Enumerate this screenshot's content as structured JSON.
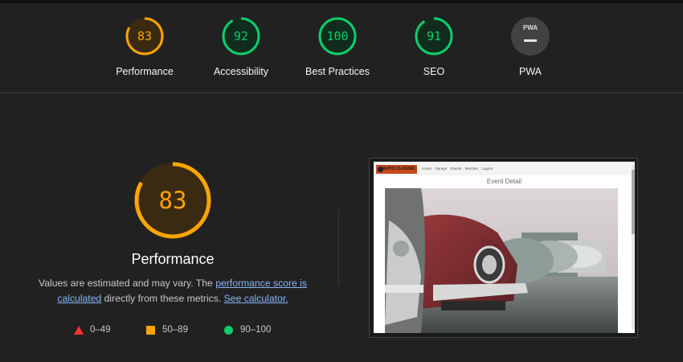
{
  "summary": {
    "categories": [
      {
        "name": "Performance",
        "score": "83",
        "level": "average",
        "fraction": 0.83
      },
      {
        "name": "Accessibility",
        "score": "92",
        "level": "pass",
        "fraction": 0.92
      },
      {
        "name": "Best Practices",
        "score": "100",
        "level": "pass",
        "fraction": 1.0
      },
      {
        "name": "SEO",
        "score": "91",
        "level": "pass",
        "fraction": 0.91
      },
      {
        "name": "PWA",
        "score": "PWA",
        "level": "pwa",
        "fraction": 0
      }
    ]
  },
  "performance": {
    "score": "83",
    "fraction": 0.83,
    "title": "Performance",
    "desc_prefix": "Values are estimated and may vary. The ",
    "desc_link1": "performance score is calculated",
    "desc_middle": " directly from these metrics. ",
    "desc_link2": "See calculator."
  },
  "legend": {
    "fail": "0–49",
    "average": "50–89",
    "pass": "90–100"
  },
  "screenshot": {
    "logo": "AUTO CLASSIC",
    "nav_links": [
      "Home",
      "Garage",
      "Events",
      "Member",
      "Logout"
    ],
    "page_title": "Event Detail"
  },
  "colors": {
    "pass": "#0cce6b",
    "average": "#ffa400",
    "fail": "#ff3333",
    "pwa": "#444444"
  }
}
